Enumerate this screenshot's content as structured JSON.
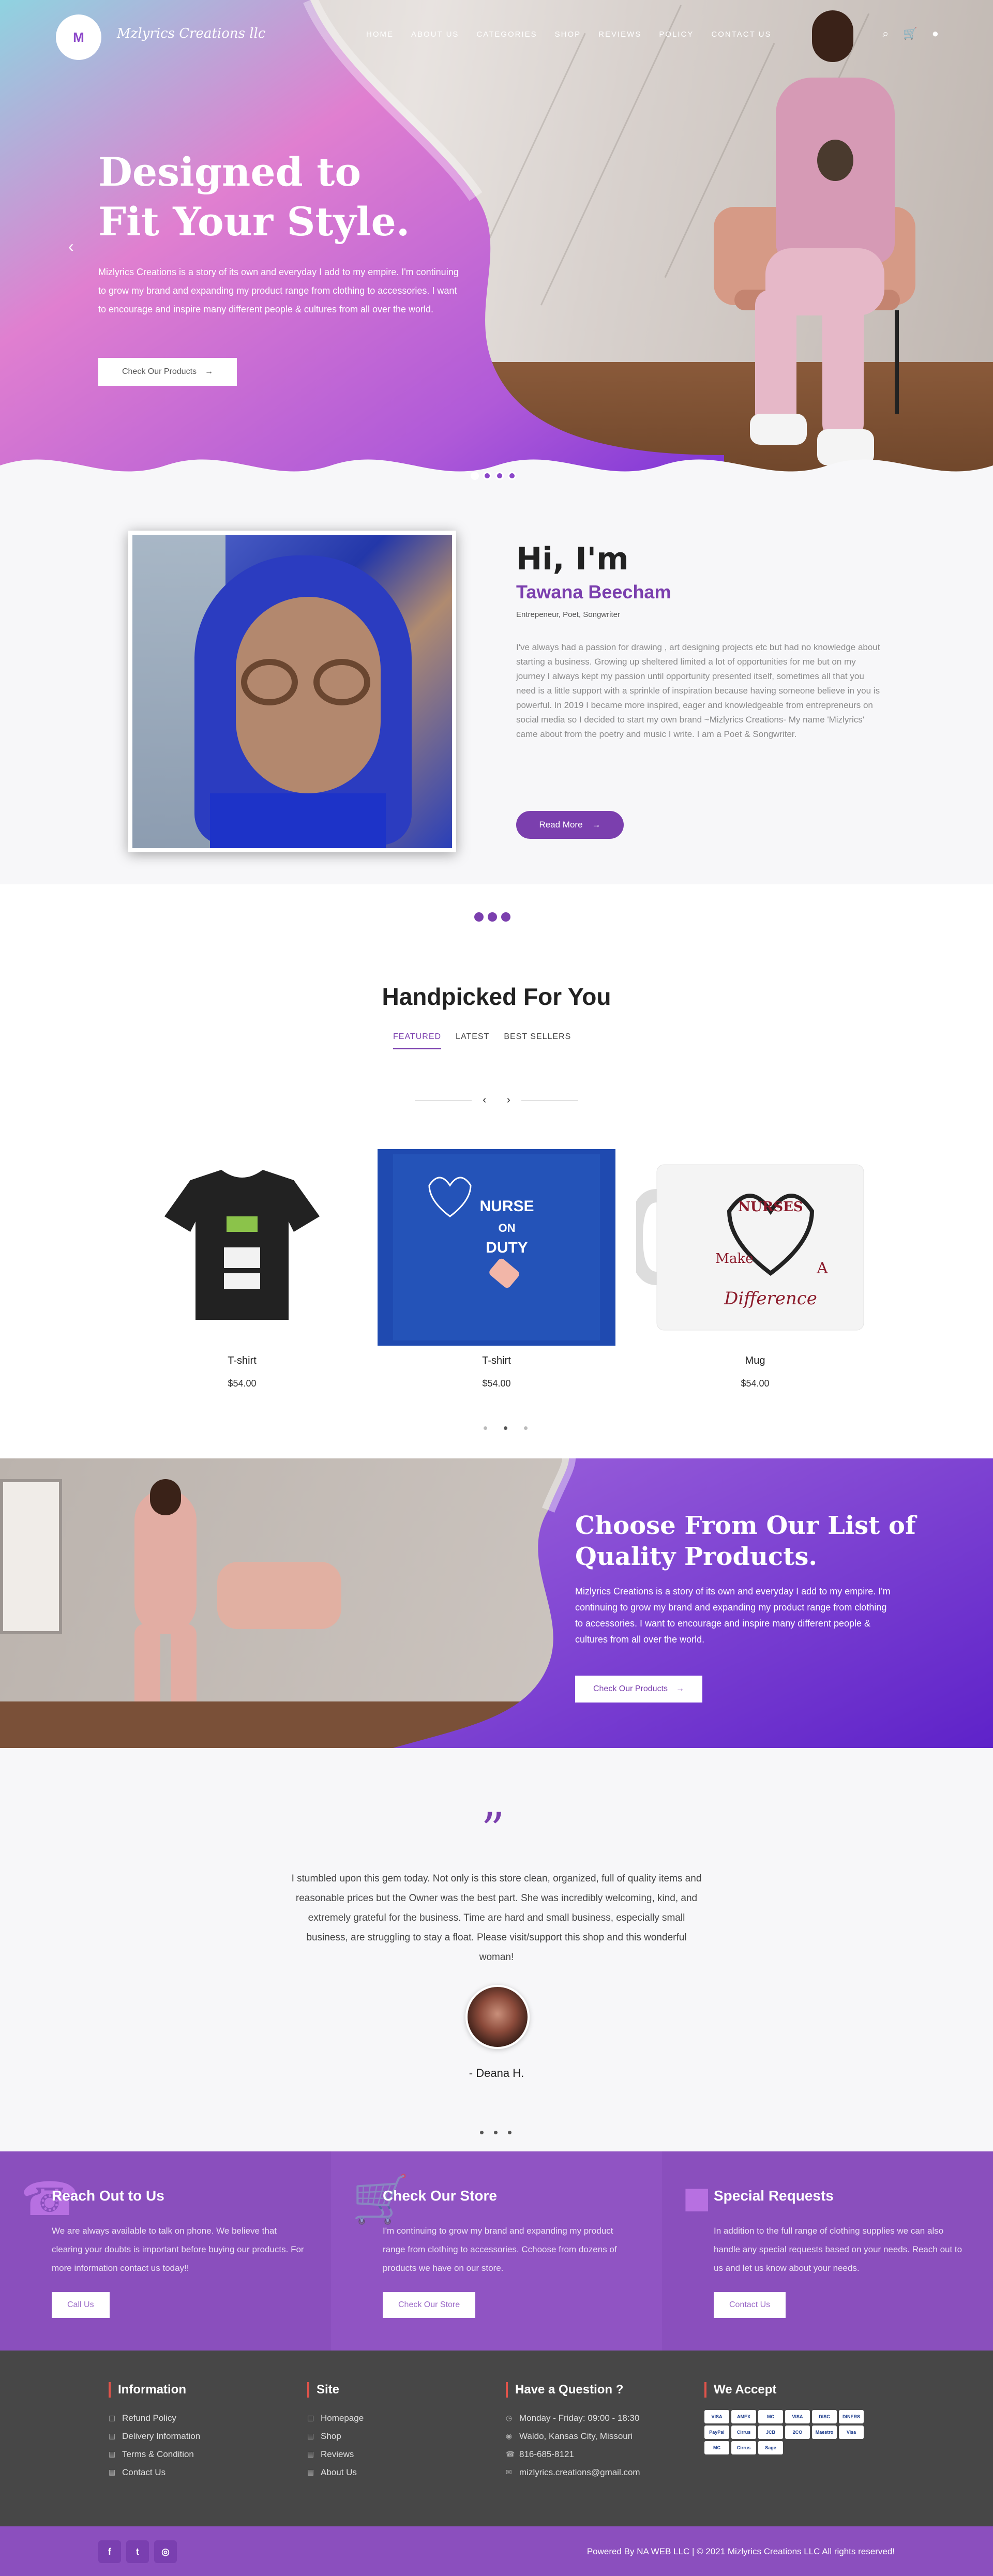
{
  "brand": {
    "name": "Mzlyrics Creations llc",
    "logo_mark": "M"
  },
  "nav": {
    "items": [
      "HOME",
      "ABOUT US",
      "CATEGORIES",
      "SHOP",
      "REVIEWS",
      "POLICY",
      "CONTACT US"
    ]
  },
  "hero": {
    "title_line1": "Designed to",
    "title_line2": "Fit Your Style.",
    "text": "Mizlyrics Creations is a story of its own and everyday I add to my empire. I'm continuing to grow my brand and expanding my product range from clothing to accessories. I want to encourage and inspire many different people & cultures from all over the world.",
    "button": "Check Our Products"
  },
  "about": {
    "hi": "Hi, I'm",
    "name": "Tawana Beecham",
    "roles": "Entrepeneur, Poet, Songwriter",
    "bio": "I've always had a passion for drawing , art designing projects etc but had no knowledge about starting a business. Growing up sheltered limited a lot of opportunities for me but on my journey I always kept my passion until opportunity presented itself, sometimes all that you need is a little support with a sprinkle of inspiration because having someone believe in you is powerful. In 2019 I became more inspired, eager and knowledgeable from entrepreneurs on social media so I decided to start my own brand ~Mizlyrics Creations- My name 'Mizlyrics' came about from the poetry and music I write. I am a Poet & Songwriter.",
    "button": "Read More"
  },
  "products": {
    "title": "Handpicked For You",
    "tabs": [
      "FEATURED",
      "LATEST",
      "BEST SELLERS"
    ],
    "items": [
      {
        "name": "T-shirt",
        "price": "$54.00"
      },
      {
        "name": "T-shirt",
        "price": "$54.00"
      },
      {
        "name": "Mug",
        "price": "$54.00"
      }
    ],
    "shirt2_text": {
      "l1": "NURSE",
      "l2": "ON",
      "l3": "DUTY"
    },
    "mug_text": {
      "l1": "NURSES",
      "l2": "Make",
      "l3": "A",
      "l4": "Difference"
    }
  },
  "banner": {
    "title_line1": "Choose From Our List of",
    "title_line2": "Quality Products.",
    "text": "Mizlyrics Creations is a story of its own and everyday I add to my empire. I'm continuing to grow my brand and expanding my product range from clothing to accessories. I want to encourage and inspire many different people & cultures from all over the world.",
    "button": "Check Our Products"
  },
  "testimonial": {
    "quote": "I stumbled upon this gem today. Not only is this store clean, organized, full of quality items and reasonable prices but the Owner was the best part. She was incredibly welcoming, kind, and extremely grateful for the business. Time are hard and small business, especially small business, are struggling to stay a float. Please visit/support this shop and this wonderful woman!",
    "author": "- Deana H."
  },
  "info": [
    {
      "title": "Reach Out to Us",
      "text": "We are always available to talk on phone. We believe that clearing your doubts is important before buying our products. For more information contact us today!!",
      "button": "Call Us",
      "icon": "phone-icon"
    },
    {
      "title": "Check Our Store",
      "text": "I'm continuing to grow my brand and expanding my product range from clothing to accessories. Cchoose from dozens of products we have on our store.",
      "button": "Check Our Store",
      "icon": "cart-icon"
    },
    {
      "title": "Special Requests",
      "text": "In addition to the full range of clothing supplies we can also handle any special requests based on your needs. Reach out to us and let us know about your needs.",
      "button": "Contact Us",
      "icon": "chat-icon"
    }
  ],
  "footer": {
    "information": {
      "title": "Information",
      "links": [
        "Refund Policy",
        "Delivery Information",
        "Terms & Condition",
        "Contact Us"
      ]
    },
    "site": {
      "title": "Site",
      "links": [
        "Homepage",
        "Shop",
        "Reviews",
        "About Us"
      ]
    },
    "question": {
      "title": "Have a Question ?",
      "items": [
        "Monday - Friday: 09:00 - 18:30",
        "Waldo, Kansas City, Missouri",
        "816-685-8121",
        "mizlyrics.creations@gmail.com"
      ]
    },
    "accept": {
      "title": "We Accept",
      "cards": [
        "VISA",
        "AMEX",
        "MC",
        "VISA",
        "DISC",
        "DINERS",
        "PayPal",
        "Cirrus",
        "JCB",
        "2CO",
        "Maestro",
        "Visa",
        "MC",
        "Cirrus",
        "Sage"
      ]
    },
    "copyright": "Powered By NA WEB LLC | © 2021 Mizlyrics Creations LLC All rights reserved!"
  },
  "colors": {
    "accent": "#7b3fae",
    "footer_bg": "#474747",
    "bar": "#8b4fbe"
  }
}
